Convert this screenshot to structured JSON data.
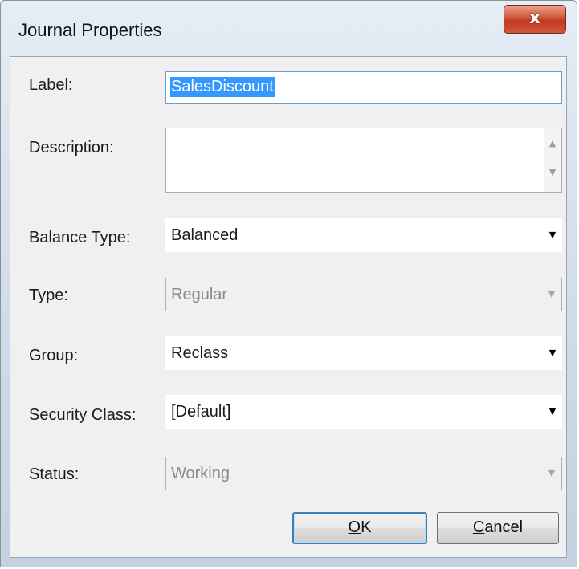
{
  "window": {
    "title": "Journal Properties",
    "close_glyph": "x"
  },
  "fields": {
    "label": {
      "label": "Label:",
      "value": "SalesDiscount"
    },
    "description": {
      "label": "Description:",
      "value": "",
      "scroll_up": "▲",
      "scroll_down": "▼"
    },
    "balance_type": {
      "label": "Balance Type:",
      "value": "Balanced",
      "dropdown": "▼"
    },
    "type": {
      "label": "Type:",
      "value": "Regular",
      "dropdown": "▼",
      "enabled": false
    },
    "group": {
      "label": "Group:",
      "value": "Reclass",
      "dropdown": "▼"
    },
    "security_class": {
      "label": "Security Class:",
      "value": "[Default]",
      "dropdown": "▼"
    },
    "status": {
      "label": "Status:",
      "value": "Working",
      "dropdown": "▼",
      "enabled": false
    }
  },
  "buttons": {
    "ok": {
      "mnemonic": "O",
      "rest": "K"
    },
    "cancel": {
      "mnemonic": "C",
      "rest": "ancel"
    }
  },
  "colors": {
    "selection": "#3399ff",
    "close_button": "#c2391f",
    "default_button_border": "#3c7fb1",
    "dialog_background": "#f0f0f0"
  }
}
